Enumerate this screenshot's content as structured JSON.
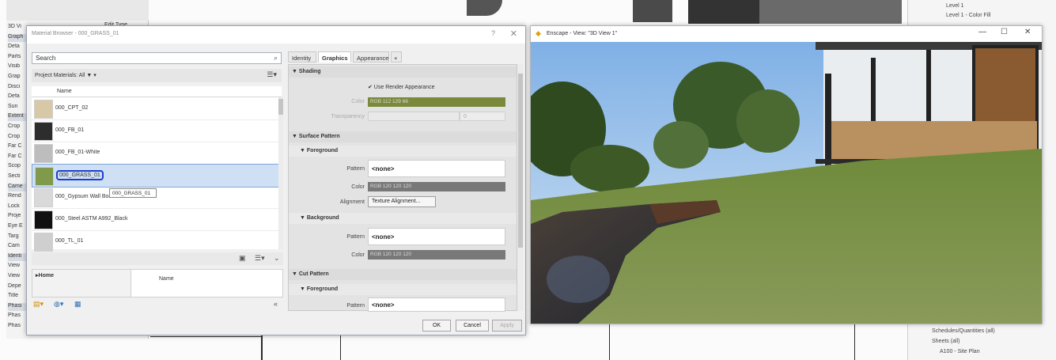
{
  "revit": {
    "props_rows": [
      {
        "label": "3D Vi",
        "cat": false
      },
      {
        "label": "Graph",
        "cat": true
      },
      {
        "label": "Deta",
        "cat": false
      },
      {
        "label": "Parts",
        "cat": false
      },
      {
        "label": "Visib",
        "cat": false
      },
      {
        "label": "Grap",
        "cat": false
      },
      {
        "label": "Disci",
        "cat": false
      },
      {
        "label": "Defa",
        "cat": false
      },
      {
        "label": "Sun",
        "cat": false
      },
      {
        "label": "Extent",
        "cat": true
      },
      {
        "label": "Crop",
        "cat": false
      },
      {
        "label": "Crop",
        "cat": false
      },
      {
        "label": "Far C",
        "cat": false
      },
      {
        "label": "Far C",
        "cat": false
      },
      {
        "label": "Scop",
        "cat": false
      },
      {
        "label": "Secti",
        "cat": false
      },
      {
        "label": "Came",
        "cat": true
      },
      {
        "label": "Rend",
        "cat": false
      },
      {
        "label": "Lock",
        "cat": false
      },
      {
        "label": "Proje",
        "cat": false
      },
      {
        "label": "Eye E",
        "cat": false
      },
      {
        "label": "Targ",
        "cat": false
      },
      {
        "label": "Cam",
        "cat": false
      },
      {
        "label": "Identi",
        "cat": true
      },
      {
        "label": "View",
        "cat": false
      },
      {
        "label": "View",
        "cat": false
      },
      {
        "label": "Depe",
        "cat": false
      },
      {
        "label": "Title",
        "cat": false
      },
      {
        "label": "Phasi",
        "cat": true
      },
      {
        "label": "Phas",
        "cat": false
      },
      {
        "label": "Phas",
        "cat": false
      }
    ],
    "props_top_right": "Edit Type",
    "project_browser_top": [
      "Level 1",
      "Level 1 - Color Fill"
    ],
    "project_browser_bottom": [
      "Schedules/Quantities (all)",
      "Sheets (all)",
      "A100 - Site Plan"
    ]
  },
  "material_browser": {
    "title": "Material Browser - 000_GRASS_01",
    "help": "?",
    "close": "✕",
    "search_placeholder": "Search",
    "project_materials": "Project Materials: All ▼ ▾",
    "list_header": "Name",
    "materials": [
      {
        "name": "000_CPT_02",
        "color": "#d8c9a6",
        "selected": false
      },
      {
        "name": "000_FB_01",
        "color": "#2d2d2d",
        "selected": false
      },
      {
        "name": "000_FB_01-White",
        "color": "#bdbdbd",
        "selected": false
      },
      {
        "name": "000_GRASS_01",
        "color": "#7e9a4a",
        "selected": true
      },
      {
        "name": "000_Gypsum Wall Board",
        "color": "#d9d9d9",
        "selected": false
      },
      {
        "name": "000_Steel ASTM A992_Black",
        "color": "#111111",
        "selected": false
      },
      {
        "name": "000_TL_01",
        "color": "#cfcfcf",
        "selected": false
      }
    ],
    "tooltip": "000_GRASS_01",
    "library_home": "▸Home",
    "library_name_header": "Name",
    "tabs": [
      "Identity",
      "Graphics",
      "Appearance",
      "+"
    ],
    "active_tab": "Graphics",
    "shading": {
      "section": "▼ Shading",
      "use_render": "✔ Use Render Appearance",
      "color_label": "Color",
      "color_value": "RGB 112 129 66",
      "color_hex": "#7a8a3a",
      "transparency_label": "Transparency",
      "transparency_value": "0"
    },
    "surface_pattern": {
      "section": "▼ Surface Pattern",
      "foreground": "▼ Foreground",
      "fg_pattern_label": "Pattern",
      "fg_pattern_value": "<none>",
      "fg_color_label": "Color",
      "fg_color_value": "RGB 120 120 120",
      "alignment_label": "Alignment",
      "alignment_button": "Texture Alignment...",
      "background": "▼ Background",
      "bg_pattern_label": "Pattern",
      "bg_pattern_value": "<none>",
      "bg_color_label": "Color",
      "bg_color_value": "RGB 120 120 120"
    },
    "cut_pattern": {
      "section": "▼ Cut Pattern",
      "foreground": "▼ Foreground",
      "fg_pattern_label": "Pattern",
      "fg_pattern_value": "<none>"
    },
    "buttons": {
      "ok": "OK",
      "cancel": "Cancel",
      "apply": "Apply"
    }
  },
  "enscape": {
    "title": "Enscape - View: \"3D View 1\"",
    "minimize": "—",
    "maximize": "☐",
    "close": "✕"
  }
}
